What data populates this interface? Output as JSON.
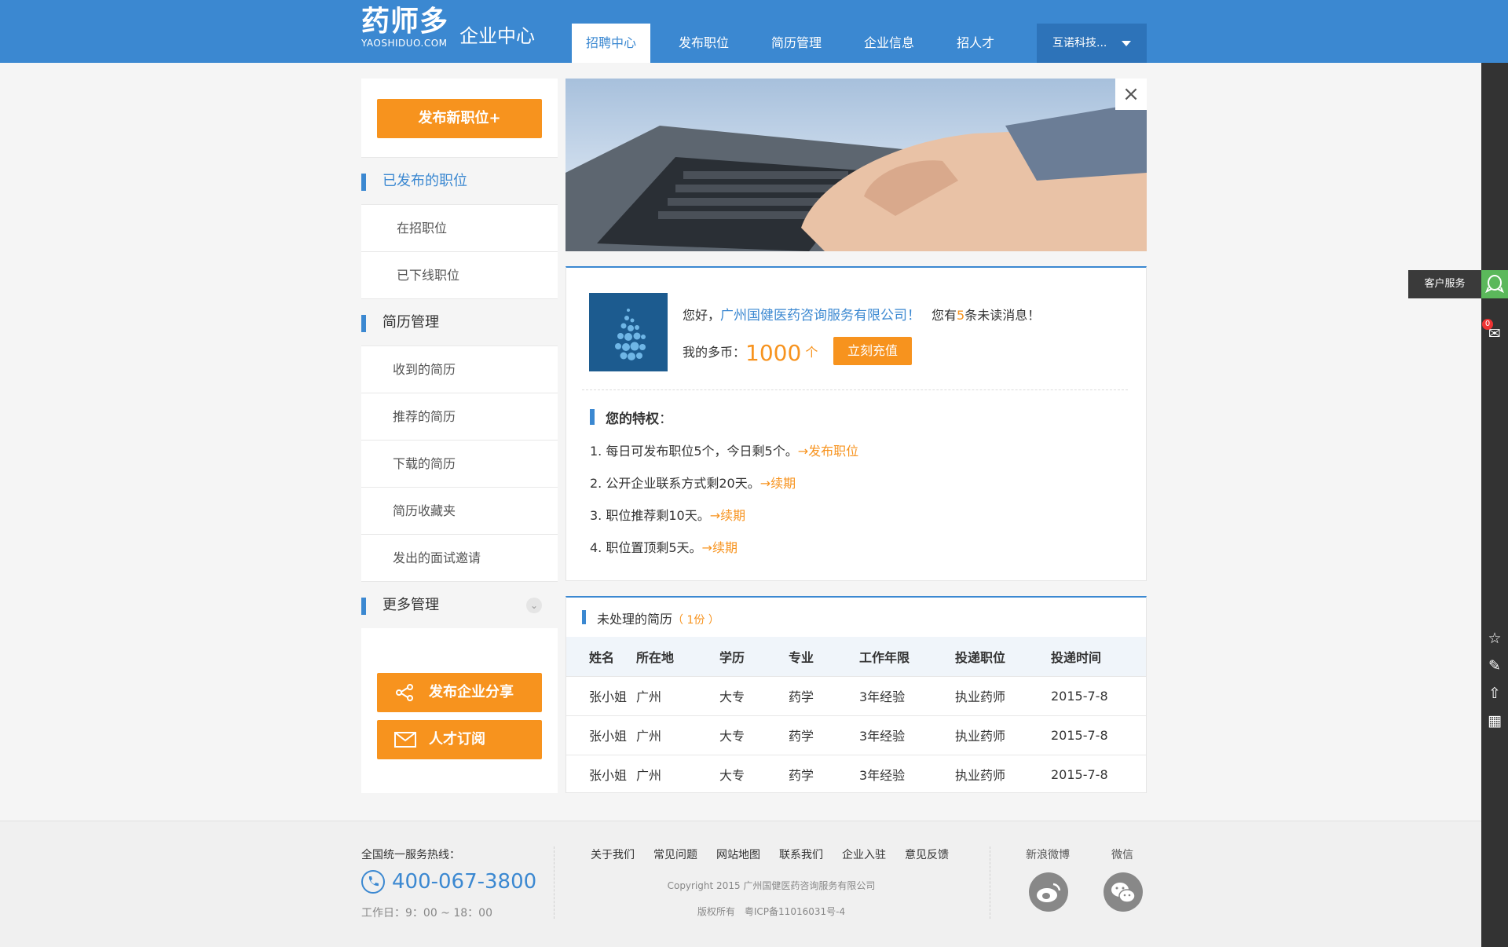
{
  "header": {
    "logo_cn": "药师多",
    "logo_en": "YAOSHIDUO.COM",
    "subtitle": "企业中心",
    "nav": [
      "招聘中心",
      "发布职位",
      "简历管理",
      "企业信息",
      "招人才"
    ],
    "company": "互诺科技..."
  },
  "sidebar": {
    "publish_btn": "发布新职位+",
    "section_posted": "已发布的职位",
    "item_active": "在招职位",
    "item_offline": "已下线职位",
    "section_resume": "简历管理",
    "resume_items": [
      "收到的简历",
      "推荐的简历",
      "下载的简历",
      "简历收藏夹",
      "发出的面试邀请"
    ],
    "section_more": "更多管理",
    "share_btn": "发布企业分享",
    "subscribe_btn": "人才订阅"
  },
  "welcome": {
    "hello": "您好，",
    "company": "广州国健医药咨询服务有限公司！",
    "msg_prefix": "您有",
    "msg_count": "5",
    "msg_suffix": "条未读消息！",
    "coins_label": "我的多币：",
    "coins_value": "1000",
    "coins_unit": "个",
    "recharge_btn": "立刻充值"
  },
  "privileges": {
    "title": "您的特权",
    "colon": "：",
    "items": [
      {
        "text": "1. 每日可发布职位5个，今日剩5个。",
        "link": "→发布职位"
      },
      {
        "text": "2. 公开企业联系方式剩20天。",
        "link": "→续期"
      },
      {
        "text": "3. 职位推荐剩10天。",
        "link": "→续期"
      },
      {
        "text": "4. 职位置顶剩5天。",
        "link": "→续期"
      }
    ]
  },
  "resumes": {
    "title": "未处理的简历",
    "count": "（ 1份 ）",
    "columns": [
      "姓名",
      "所在地",
      "学历",
      "专业",
      "工作年限",
      "投递职位",
      "投递时间"
    ],
    "rows": [
      [
        "张小姐",
        "广州",
        "大专",
        "药学",
        "3年经验",
        "执业药师",
        "2015-7-8"
      ],
      [
        "张小姐",
        "广州",
        "大专",
        "药学",
        "3年经验",
        "执业药师",
        "2015-7-8"
      ],
      [
        "张小姐",
        "广州",
        "大专",
        "药学",
        "3年经验",
        "执业药师",
        "2015-7-8"
      ]
    ]
  },
  "footer": {
    "hotline_label": "全国统一服务热线：",
    "hotline": "400-067-3800",
    "workday": "工作日：9：00 ~ 18：00",
    "links": [
      "关于我们",
      "常见问题",
      "网站地图",
      "联系我们",
      "企业入驻",
      "意见反馈"
    ],
    "copyright": "Copyright 2015 广州国健医药咨询服务有限公司",
    "license": "版权所有　粤ICP备11016031号-4",
    "weibo": "新浪微博",
    "wechat": "微信"
  },
  "rail": {
    "customer_service": "客户服务",
    "badge": "0"
  },
  "colors": {
    "primary": "#3b88d1",
    "accent": "#f7931e",
    "rail": "#333333"
  }
}
